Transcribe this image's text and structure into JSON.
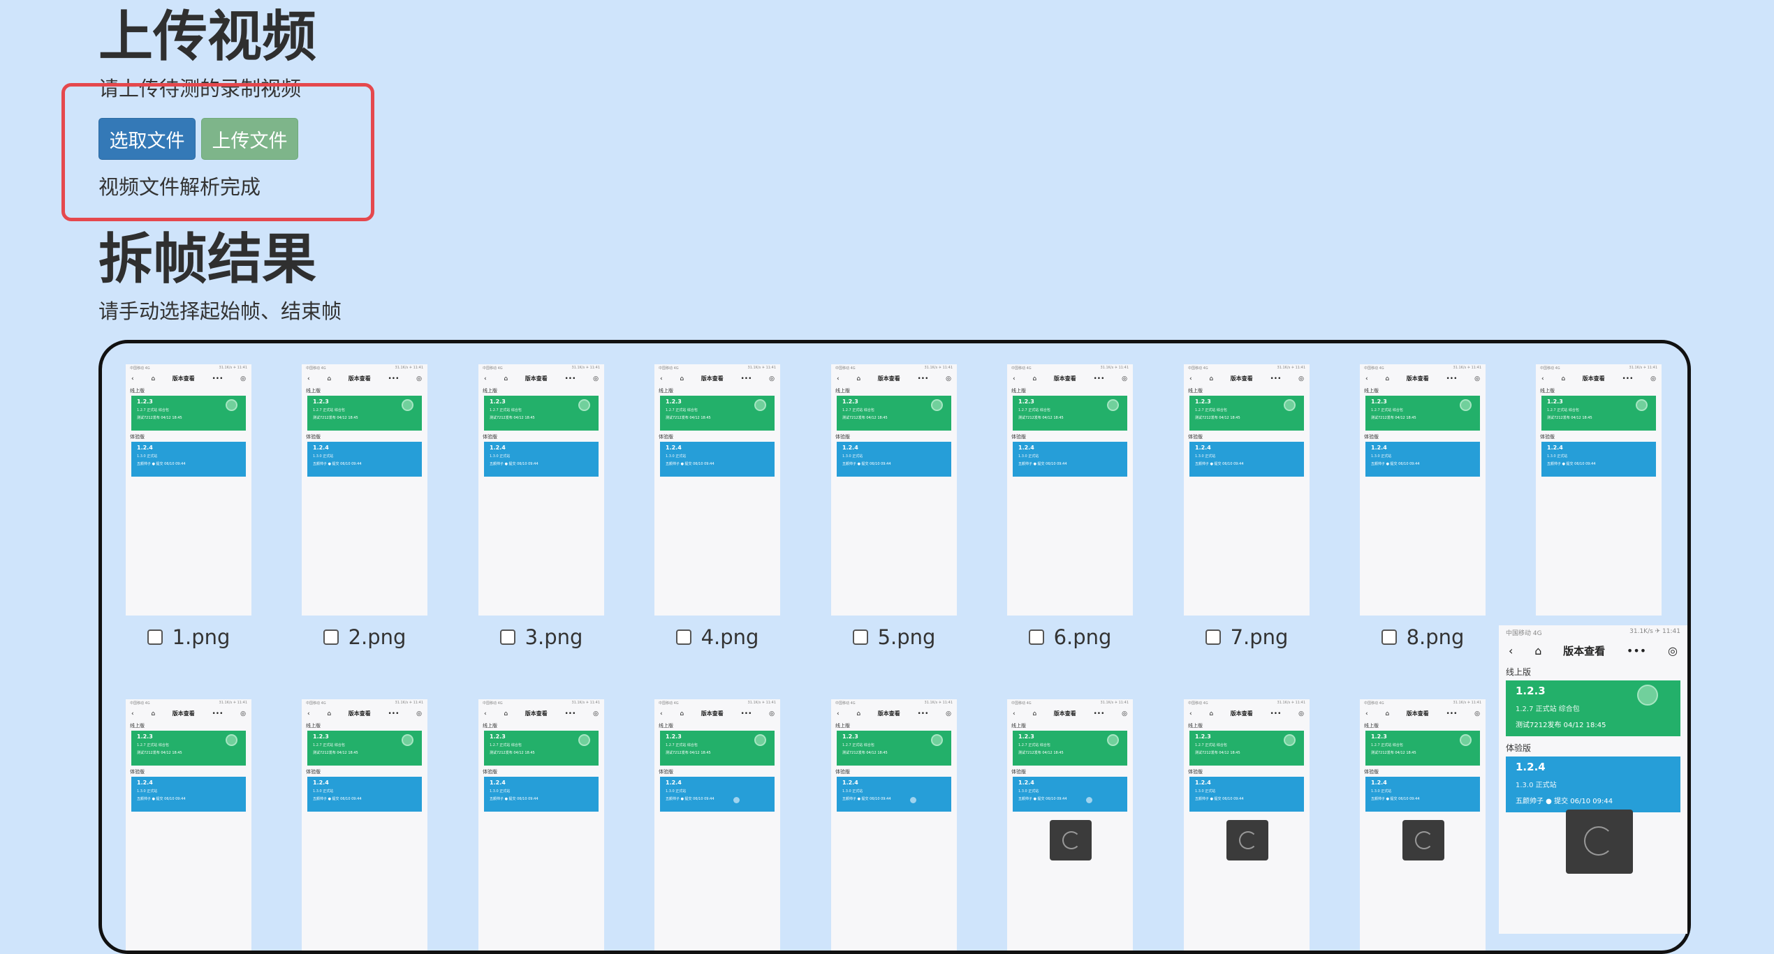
{
  "upload": {
    "title": "上传视频",
    "subtitle": "请上传待测的录制视频",
    "pick_button": "选取文件",
    "upload_button": "上传文件",
    "status": "视频文件解析完成"
  },
  "frames": {
    "title": "拆帧结果",
    "subtitle": "请手动选择起始帧、结束帧",
    "row1_labels": [
      "1.png",
      "2.png",
      "3.png",
      "4.png",
      "5.png",
      "6.png",
      "7.png",
      "8.png"
    ],
    "thumb": {
      "status_left": "中国移动 4G",
      "status_right": "31.1K/s ✈ 11:41",
      "nav_title": "版本查看",
      "section_online": "线上版",
      "online_version": "1.2.3",
      "online_desc": "1.2.7 正式站 综合包",
      "online_meta": "测试7212发布 04/12 18:45",
      "section_trial": "体验版",
      "trial_version": "1.2.4",
      "trial_desc": "1.3.0 正式站",
      "trial_meta": "五颜帅子 ● 提交 06/10 09:44"
    }
  },
  "colors": {
    "page_bg": "#cfe4fb",
    "highlight_box": "#e5484d",
    "online_card": "#23b06a",
    "trial_card": "#269ed8"
  }
}
